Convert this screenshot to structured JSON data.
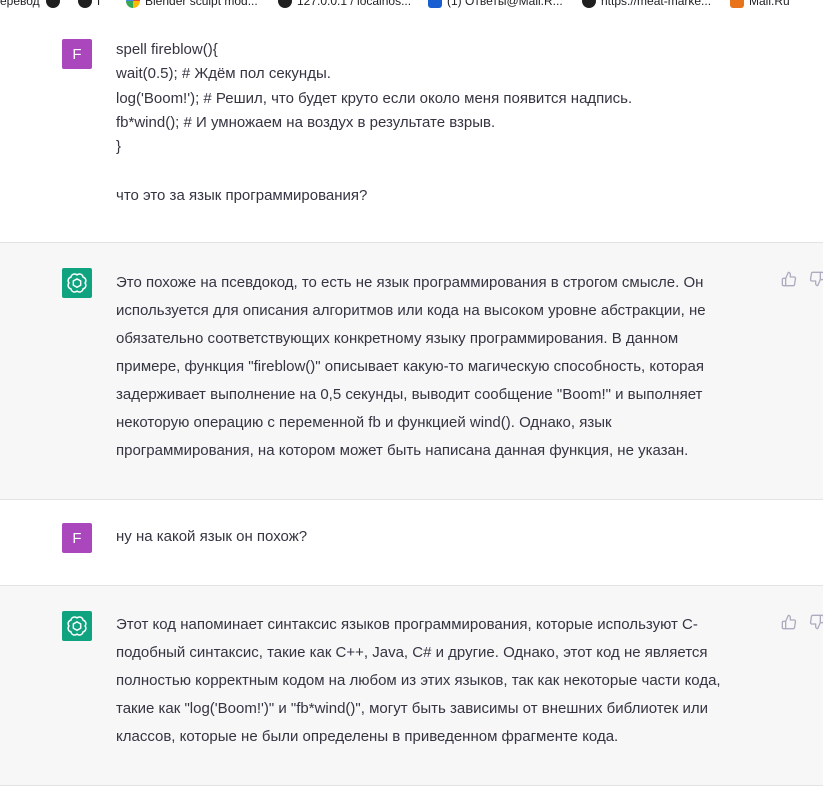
{
  "bookmarks": [
    {
      "icon": "dark-circle-icon",
      "label": "еревод"
    },
    {
      "icon": "dark-circle-icon",
      "label": ""
    },
    {
      "icon": "dark-circle-icon",
      "label": "Г"
    },
    {
      "icon": "google-icon",
      "label": "Blender sculpt mod..."
    },
    {
      "icon": "dark-circle-icon",
      "label": "127.0.0.1 / localhos..."
    },
    {
      "icon": "mail-icon",
      "label": "(1) Ответы@Mail.R..."
    },
    {
      "icon": "dark-circle-icon",
      "label": "https://meat-marke..."
    },
    {
      "icon": "mail-icon",
      "label": "Mail.Ru"
    }
  ],
  "messages": [
    {
      "role": "user",
      "avatar_letter": "F",
      "code_lines": [
        "spell fireblow(){",
        "wait(0.5); # Ждём пол секунды.",
        "log('Boom!'); # Решил, что будет круто если около меня появится надпись.",
        "fb*wind(); # И умножаем на воздух в результате взрыв.",
        "}",
        "",
        "что это за язык программирования?"
      ]
    },
    {
      "role": "assistant",
      "lines": [
        "Это похоже на псевдокод, то есть не язык программирования в строгом смысле. Он",
        "используется для описания алгоритмов или кода на высоком уровне абстракции, не",
        "обязательно соответствующих конкретному языку программирования. В данном",
        "примере, функция \"fireblow()\" описывает какую-то магическую способность, которая",
        "задерживает выполнение на 0,5 секунды, выводит сообщение \"Boom!\" и выполняет",
        "некоторую операцию с переменной fb и функцией wind(). Однако, язык",
        "программирования, на котором может быть написана данная функция, не указан."
      ]
    },
    {
      "role": "user",
      "avatar_letter": "F",
      "text": "ну на какой язык он похож?"
    },
    {
      "role": "assistant",
      "lines": [
        "Этот код напоминает синтаксис языков программирования, которые используют C-",
        "подобный синтаксис, такие как C++, Java, C# и другие. Однако, этот код не является",
        "полностью корректным кодом на любом из этих языков, так как некоторые части кода,",
        "такие как \"log('Boom!')\" и \"fb*wind()\", могут быть зависимы от внешних библиотек или",
        "классов, которые не были определены в приведенном фрагменте кода."
      ]
    }
  ],
  "colors": {
    "user_avatar": "#ab47bc",
    "assistant_avatar": "#10a37f",
    "assistant_bg": "#f7f7f8",
    "text": "#343541"
  }
}
